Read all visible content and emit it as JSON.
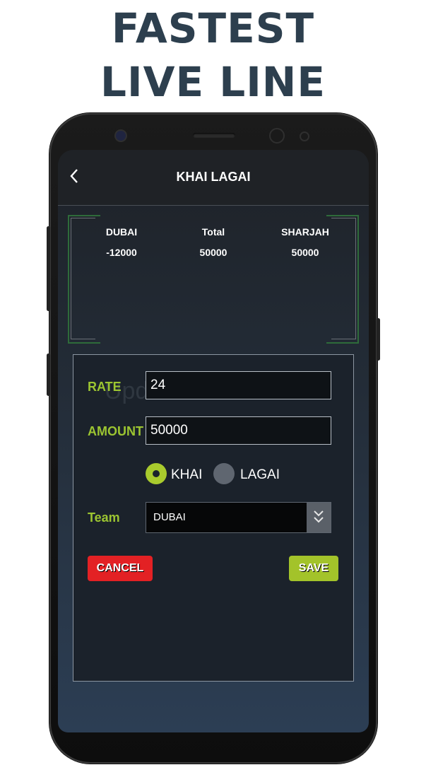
{
  "promo": {
    "line1": "FASTEST",
    "line2": "LIVE LINE"
  },
  "header": {
    "back_icon": "chevron-left-icon",
    "title": "KHAI LAGAI"
  },
  "summary": {
    "columns": [
      {
        "label": "DUBAI",
        "value": "-12000"
      },
      {
        "label": "Total",
        "value": "50000"
      },
      {
        "label": "SHARJAH",
        "value": "50000"
      }
    ]
  },
  "watermark": "UpdateStar.com",
  "form": {
    "rate_label": "RATE",
    "rate_value": "24",
    "amount_label": "AMOUNT",
    "amount_value": "50000",
    "khai_label": "KHAI",
    "lagai_label": "LAGAI",
    "selected_option": "KHAI",
    "team_label": "Team",
    "team_value": "DUBAI",
    "cancel_label": "CANCEL",
    "save_label": "SAVE"
  },
  "colors": {
    "accent_green": "#a9cb2d",
    "cancel_red": "#e32124",
    "promo_text": "#2d3f4e"
  }
}
